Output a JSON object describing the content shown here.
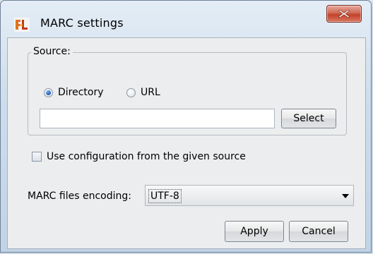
{
  "window": {
    "title": "MARC settings",
    "icon": "app-logo-icon",
    "close_icon": "close-icon"
  },
  "source": {
    "legend": "Source:",
    "options": [
      {
        "label": "Directory",
        "selected": true
      },
      {
        "label": "URL",
        "selected": false
      }
    ],
    "path_value": "",
    "select_label": "Select"
  },
  "use_config": {
    "label": "Use configuration from the given source",
    "checked": false
  },
  "encoding": {
    "label": "MARC files encoding:",
    "selected": "UTF-8"
  },
  "buttons": {
    "apply_label": "Apply",
    "cancel_label": "Cancel"
  }
}
